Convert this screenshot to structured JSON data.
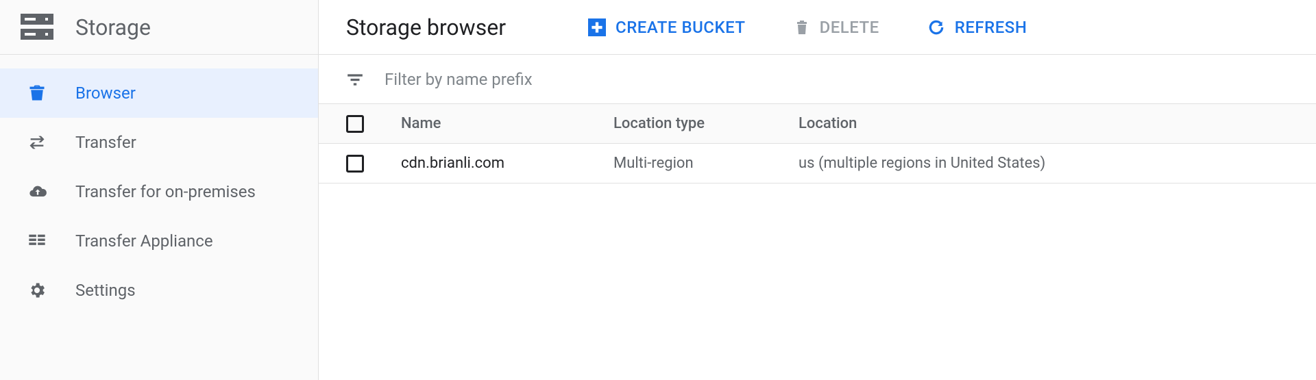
{
  "sidebar": {
    "title": "Storage",
    "items": [
      {
        "label": "Browser",
        "icon": "bucket-icon",
        "active": true
      },
      {
        "label": "Transfer",
        "icon": "transfer-icon",
        "active": false
      },
      {
        "label": "Transfer for on-premises",
        "icon": "cloud-upload-icon",
        "active": false
      },
      {
        "label": "Transfer Appliance",
        "icon": "appliance-icon",
        "active": false
      },
      {
        "label": "Settings",
        "icon": "gear-icon",
        "active": false
      }
    ]
  },
  "header": {
    "page_title": "Storage browser",
    "actions": {
      "create_bucket": "CREATE BUCKET",
      "delete": "DELETE",
      "refresh": "REFRESH"
    }
  },
  "filter": {
    "placeholder": "Filter by name prefix"
  },
  "table": {
    "columns": {
      "name": "Name",
      "location_type": "Location type",
      "location": "Location"
    },
    "rows": [
      {
        "name": "cdn.brianli.com",
        "location_type": "Multi-region",
        "location": "us (multiple regions in United States)"
      }
    ]
  }
}
